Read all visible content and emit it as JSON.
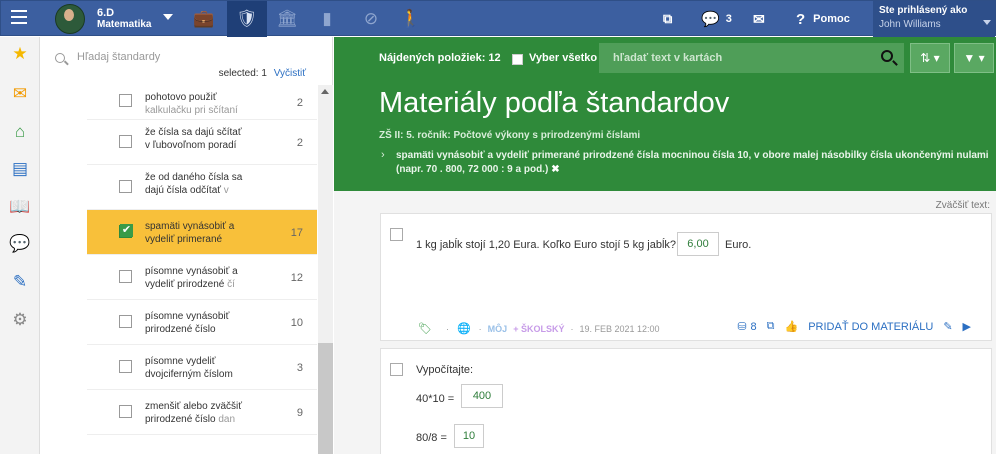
{
  "header": {
    "class_name": "6.D",
    "subject": "Matematika",
    "messages_count": "3",
    "help_label": "Pomoc",
    "user_label": "Ste prihlásený ako",
    "user_name": "John Williams"
  },
  "sidebar": {
    "search_placeholder": "Hľadaj štandardy",
    "selected_label": "selected: 1",
    "clear_label": "Vyčistiť",
    "items": [
      {
        "text_main": "pohotovo použiť",
        "text_fade": "kalkulačku pri sčítaní",
        "count": "2",
        "checked": false
      },
      {
        "text_main": "že čísla sa dajú sčítať v ľubovoľnom poradí",
        "text_fade": "",
        "count": "2",
        "checked": false
      },
      {
        "text_main": "že od daného čísla sa dajú čísla odčítať",
        "text_fade": "v",
        "count": "",
        "checked": false
      },
      {
        "text_main": "spamäti vynásobiť a vydeliť primerané",
        "text_fade": "",
        "count": "17",
        "checked": true
      },
      {
        "text_main": "písomne vynásobiť a vydeliť prirodzené",
        "text_fade": "čí",
        "count": "12",
        "checked": false
      },
      {
        "text_main": "písomne vynásobiť prirodzené číslo",
        "text_fade": "",
        "count": "10",
        "checked": false
      },
      {
        "text_main": "písomne vydeliť dvojciferným číslom",
        "text_fade": "",
        "count": "3",
        "checked": false
      },
      {
        "text_main": "zmenšiť alebo zväčšiť prirodzené číslo",
        "text_fade": "dan",
        "count": "9",
        "checked": false
      }
    ]
  },
  "toolbar": {
    "found_label": "Nájdených položiek: 12",
    "select_all_label": "Vyber všetko",
    "search_placeholder": "hľadať text v kartách"
  },
  "main": {
    "title": "Materiály podľa štandardov",
    "breadcrumb": "ZŠ II: 5. ročník: Počtové výkony s prirodzenými číslami",
    "standard_line1": "spamäti vynásobiť a vydeliť primerané prirodzené čísla mocninou čísla 10, v obore malej násobilky čísla ukončenými nulami",
    "standard_line2": "(napr. 70 . 800, 72 000 : 9 a pod.)",
    "zoom_label": "Zväčšiť text:"
  },
  "cards": [
    {
      "question": "1 kg jabĺk stojí 1,20 Eura. Koľko Euro stojí 5 kg jabĺk?",
      "answer": "6,00",
      "unit": "Euro.",
      "owner": "MÔJ",
      "plus": "+ ŠKOLSKÝ",
      "date": "19. FEB 2021 12:00",
      "db_count": "8",
      "add_label": "PRIDAŤ DO MATERIÁLU"
    },
    {
      "question": "Vypočítajte:",
      "eq1": "40*10 =",
      "ans1": "400",
      "eq2": "80/8 =",
      "ans2": "10"
    }
  ],
  "colors": {
    "topbar": "#3c5fa0",
    "hero": "#2f8a3a",
    "selected_item": "#f8c03a",
    "link": "#2b6fc2"
  }
}
